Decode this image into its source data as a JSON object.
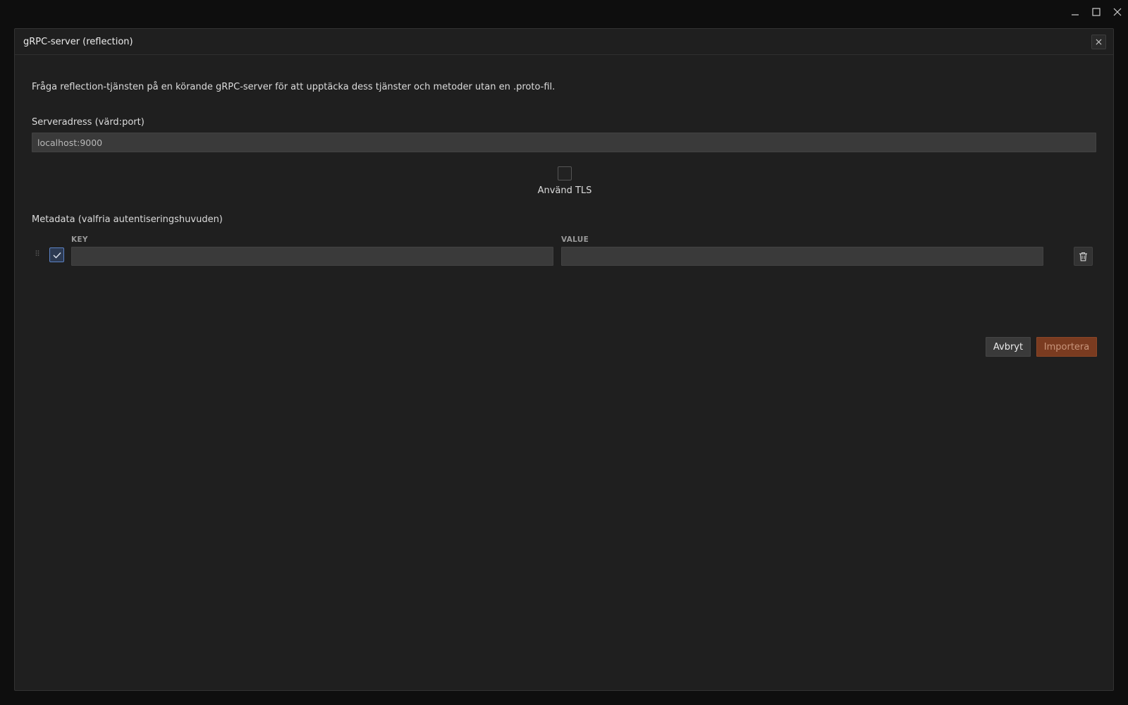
{
  "window": {
    "minimize_icon": "minimize-icon",
    "maximize_icon": "maximize-icon",
    "close_icon": "close-icon"
  },
  "dialog": {
    "title": "gRPC-server (reflection)",
    "description": "Fråga reflection-tjänsten på en körande gRPC-server för att upptäcka dess tjänster och metoder utan en .proto-fil.",
    "address": {
      "label": "Serveradress (värd:port)",
      "value": "localhost:9000"
    },
    "tls": {
      "label": "Använd TLS",
      "checked": false
    },
    "metadata": {
      "label": "Metadata (valfria autentiseringshuvuden)",
      "columns": {
        "key": "KEY",
        "value": "VALUE"
      },
      "rows": [
        {
          "enabled": true,
          "key": "",
          "value": ""
        }
      ]
    },
    "buttons": {
      "cancel": "Avbryt",
      "import": "Importera"
    },
    "colors": {
      "accent_import": "#7a3b20",
      "checkbox_accent": "#5c82c4",
      "background": "#1f1f1f"
    }
  }
}
